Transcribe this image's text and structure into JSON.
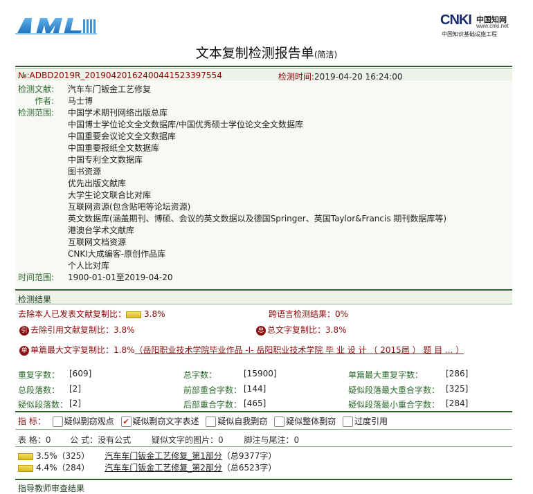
{
  "header": {
    "report_title": "文本复制检测报告单",
    "report_variant": "(简洁)",
    "cnki_logo": "CNKI",
    "cnki_cn": "中国知网",
    "cnki_url": "www.cnki.net",
    "cnki_sub": "中国知识基础设施工程"
  },
  "meta": {
    "report_no": "№:ADBD2019R_20190420162400441523397554",
    "check_time_label": "检测时间:",
    "check_time": "2019-04-20 16:24:00",
    "doc_label": "检测文献:",
    "doc_value": "汽车车门钣金工艺修复",
    "author_label": "作者:",
    "author_value": "马士博",
    "range_label": "检测范围:",
    "databases": [
      "中国学术期刊网络出版总库",
      "中国博士学位论文全文数据库/中国优秀硕士学位论文全文数据库",
      "中国重要会议论文全文数据库",
      "中国重要报纸全文数据库",
      "中国专利全文数据库",
      "图书资源",
      "优先出版文献库",
      "大学生论文联合比对库",
      "互联网资源(包含贴吧等论坛资源)",
      "英文数据库(涵盖期刊、博硕、会议的英文数据以及德国Springer、英国Taylor&Francis 期刊数据库等)",
      "港澳台学术文献库",
      "互联网文档资源",
      "CNKI大成编客-原创作品库",
      "个人比对库"
    ],
    "time_range_label": "时间范围:",
    "time_range": "1900-01-01至2019-04-20"
  },
  "results": {
    "section_title": "检测结果",
    "self_removed_label": "去除本人已发表文献复制比：",
    "self_removed_value": "3.8%",
    "cross_lang_label": "跨语言检测结果：",
    "cross_lang_value": "0%",
    "cite_removed_icon": "引",
    "cite_removed_label": "去除引用文献复制比：",
    "cite_removed_value": "3.8%",
    "total_icon": "总",
    "total_label": "总文字复制比：",
    "total_value": "3.8%",
    "single_icon": "单",
    "single_label": "单篇最大文字复制比：",
    "single_value": "1.8%",
    "single_source": "（岳阳职业技术学院毕业作品 -I- 岳阳职业技术学院 毕 业 设 计 （ 2015届 ） 题 目 ... ）",
    "stats": [
      {
        "label": "重复字数：",
        "value": "[609]"
      },
      {
        "label": "总字数：",
        "value": "[15900]"
      },
      {
        "label": "单篇最大重复字数：",
        "value": "[286]"
      },
      {
        "label": "总段落数：",
        "value": "[2]"
      },
      {
        "label": "前部重合字数：",
        "value": "[144]"
      },
      {
        "label": "疑似段落最大重合字数：",
        "value": "[325]"
      },
      {
        "label": "疑似段落数：",
        "value": "[2]"
      },
      {
        "label": "后部重合字数：",
        "value": "[465]"
      },
      {
        "label": "疑似段落最小重合字数：",
        "value": "[284]"
      }
    ],
    "indicator_label": "指  标：",
    "indicators": [
      {
        "label": "疑似剽窃观点",
        "checked": false
      },
      {
        "label": "疑似剽窃文字表述",
        "checked": true
      },
      {
        "label": "疑似自我剽窃",
        "checked": false
      },
      {
        "label": "疑似整体剽窃",
        "checked": false
      },
      {
        "label": "过度引用",
        "checked": false
      }
    ],
    "tables_label": "表  格：",
    "tables_value": "0",
    "formulas_label": "公  式：",
    "formulas_value": "没有公式",
    "images_label": "疑似文字的图片：",
    "images_value": "0",
    "notes_label": "脚注与尾注：",
    "notes_value": "0",
    "parts": [
      {
        "pct": "3.5%（325）",
        "name": "汽车车门钣金工艺修复_第1部分",
        "words": "（总9377字）"
      },
      {
        "pct": "4.4%（284）",
        "name": "汽车车门钣金工艺修复_第2部分",
        "words": "（总6523字）"
      }
    ],
    "footer_cut": "指导教师审查结果"
  }
}
